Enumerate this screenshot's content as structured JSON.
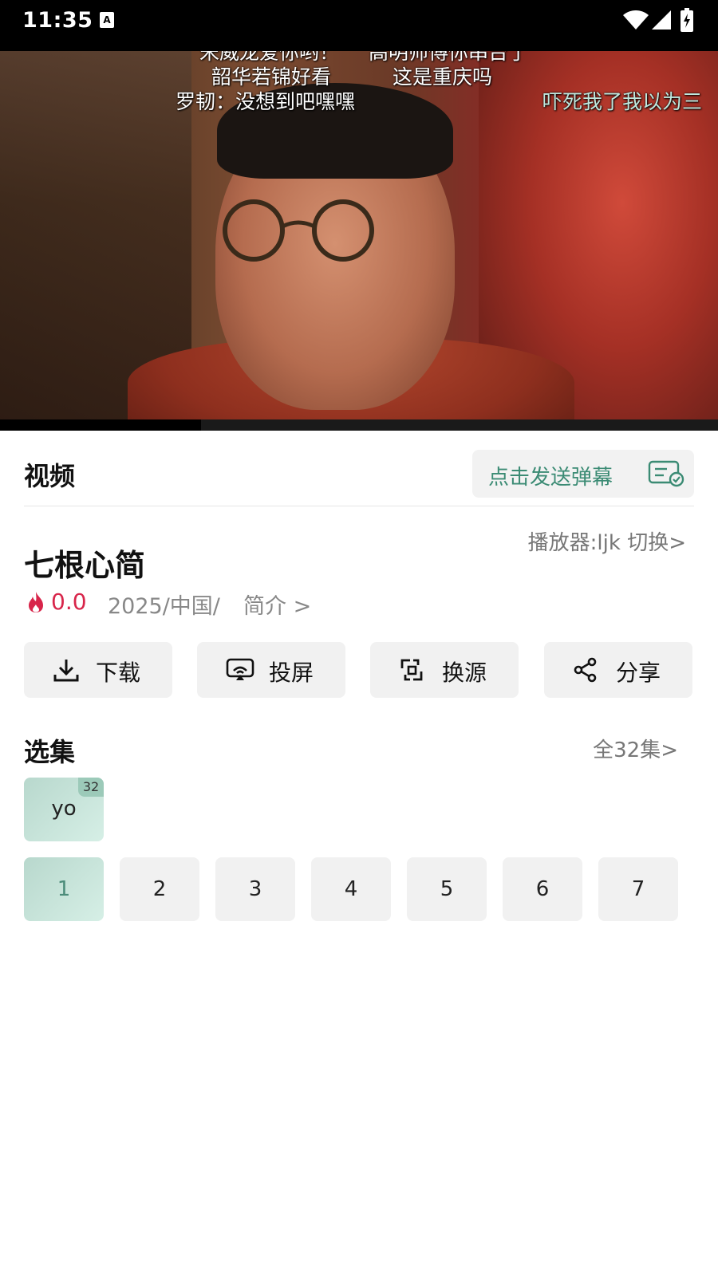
{
  "status_bar": {
    "time": "11:35"
  },
  "video": {
    "danmaku": [
      "宋威龙爱你哟！",
      "高明师傅你串台了",
      "韶华若锦好看",
      "这是重庆吗",
      "罗韧：没想到吧嘿嘿",
      "吓死我了我以为三"
    ],
    "progress": 0.28
  },
  "header": {
    "tab_label": "视频",
    "send_danmaku_label": "点击发送弹幕"
  },
  "detail": {
    "title": "七根心简",
    "player_switch": "播放器:ljk 切换>",
    "score": "0.0",
    "info": "2025/中国/",
    "intro_link": "简介 >"
  },
  "actions": [
    {
      "label": "下载",
      "icon": "download-icon"
    },
    {
      "label": "投屏",
      "icon": "cast-icon"
    },
    {
      "label": "换源",
      "icon": "switch-source-icon"
    },
    {
      "label": "分享",
      "icon": "share-icon"
    }
  ],
  "episodes": {
    "title": "选集",
    "all_label": "全32集>",
    "source": {
      "name": "yo",
      "count": "32"
    },
    "items": [
      "1",
      "2",
      "3",
      "4",
      "5",
      "6",
      "7"
    ],
    "active": "1"
  },
  "colors": {
    "accent_green": "#3b8b74",
    "score_red": "#d8254a",
    "chip_green": "#d6efe6"
  }
}
